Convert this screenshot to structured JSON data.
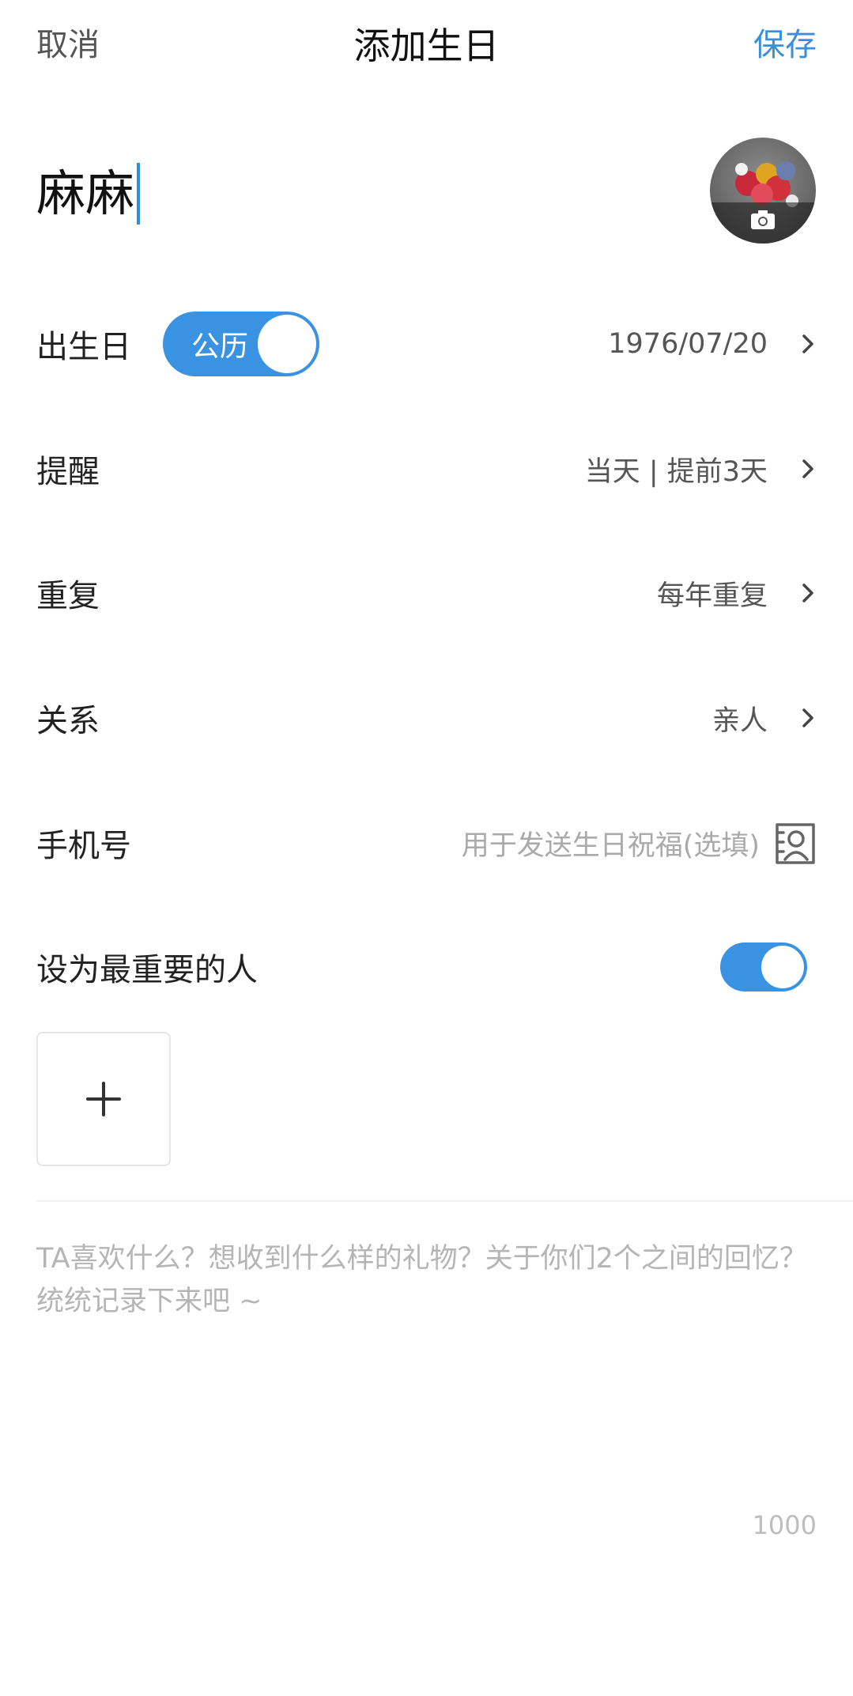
{
  "header": {
    "cancel_label": "取消",
    "title": "添加生日",
    "save_label": "保存"
  },
  "name_input": {
    "value": "麻麻"
  },
  "avatar": {
    "icon": "camera-icon"
  },
  "rows": {
    "birthday": {
      "label": "出生日",
      "calendar_toggle_label": "公历",
      "value": "1976/07/20"
    },
    "reminder": {
      "label": "提醒",
      "value": "当天 | 提前3天"
    },
    "repeat": {
      "label": "重复",
      "value": "每年重复"
    },
    "relation": {
      "label": "关系",
      "value": "亲人"
    },
    "phone": {
      "label": "手机号",
      "placeholder": "用于发送生日祝福(选填)",
      "icon": "contacts-icon"
    },
    "important": {
      "label": "设为最重要的人",
      "enabled": true
    }
  },
  "add_photo": {
    "icon": "plus-icon"
  },
  "memo": {
    "placeholder": "TA喜欢什么？想收到什么样的礼物？关于你们2个之间的回忆？统统记录下来吧 ~",
    "counter": "1000"
  },
  "colors": {
    "accent": "#3a93e2",
    "caret": "#2f8fe6"
  }
}
